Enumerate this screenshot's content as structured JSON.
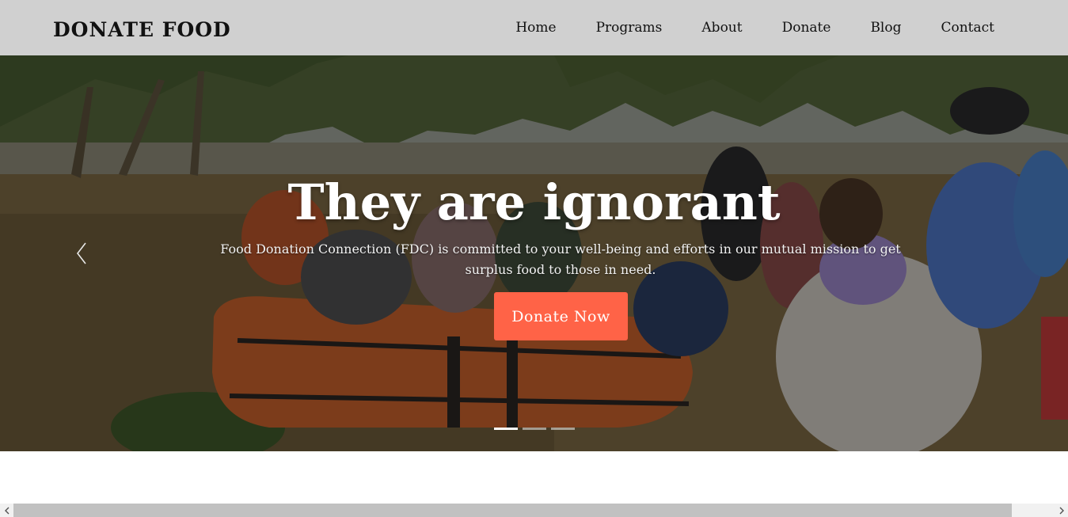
{
  "navbar": {
    "brand": "DONATE FOOD",
    "links": [
      "Home",
      "Programs",
      "About",
      "Donate",
      "Blog",
      "Contact"
    ]
  },
  "hero": {
    "title": "They are ignorant",
    "description": "Food Donation Connection (FDC) is committed to your well-being and efforts in our mutual mission to get surplus food to those in need.",
    "button_label": "Donate Now",
    "slide_count": 3,
    "active_slide": 1,
    "prev_icon": "chevron-left-icon"
  },
  "colors": {
    "navbar_bg": "#d0d0d0",
    "accent": "#ff6347",
    "text_dark": "#111111"
  },
  "scrollbar": {
    "left_icon": "chevron-left-icon",
    "right_icon": "chevron-right-icon"
  }
}
